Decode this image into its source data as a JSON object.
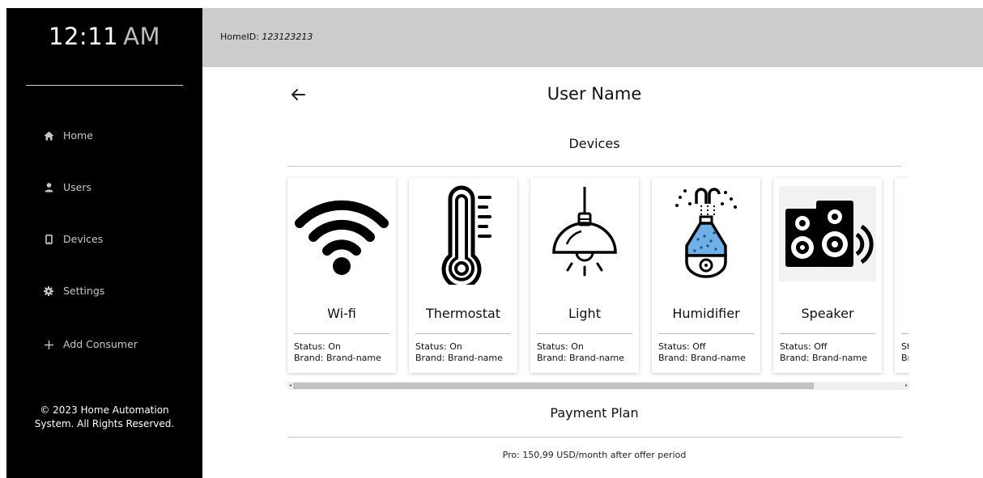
{
  "sidebar": {
    "time": "12:11",
    "ampm": "AM",
    "items": [
      {
        "label": "Home",
        "icon": "home-icon"
      },
      {
        "label": "Users",
        "icon": "user-icon"
      },
      {
        "label": "Devices",
        "icon": "device-icon"
      },
      {
        "label": "Settings",
        "icon": "gear-icon"
      },
      {
        "label": "Add Consumer",
        "icon": "plus-icon"
      }
    ],
    "footer_line1": "© 2023 Home Automation",
    "footer_line2": "System. All Rights Reserved."
  },
  "header": {
    "home_id_label": "HomeID:",
    "home_id_value": "123123213"
  },
  "main": {
    "back_icon": "arrow-left-icon",
    "user_name": "User Name",
    "devices_title": "Devices",
    "devices": [
      {
        "name": "Wi-fi",
        "status": "Status: On",
        "brand": "Brand: Brand-name",
        "icon": "wifi-icon"
      },
      {
        "name": "Thermostat",
        "status": "Status: On",
        "brand": "Brand: Brand-name",
        "icon": "thermometer-icon"
      },
      {
        "name": "Light",
        "status": "Status: On",
        "brand": "Brand: Brand-name",
        "icon": "lamp-icon"
      },
      {
        "name": "Humidifier",
        "status": "Status: Off",
        "brand": "Brand: Brand-name",
        "icon": "humidifier-icon"
      },
      {
        "name": "Speaker",
        "status": "Status: Off",
        "brand": "Brand: Brand-name",
        "icon": "speaker-icon"
      },
      {
        "name": "",
        "status": "Status: On",
        "brand": "Brand: Brand-name",
        "icon": ""
      }
    ],
    "payment_title": "Payment Plan",
    "plan_text": "Pro: 150,99 USD/month after offer period"
  },
  "colors": {
    "sidebar_bg": "#000000",
    "header_bg": "#cccccc",
    "humidifier_accent": "#6fb1e6"
  }
}
